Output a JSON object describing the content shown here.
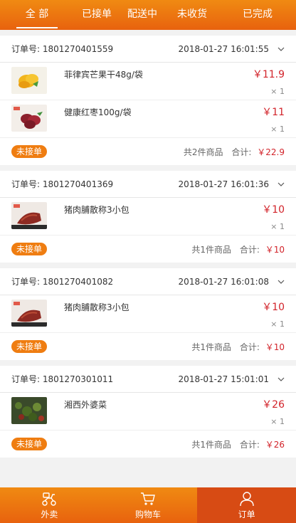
{
  "tabs": [
    {
      "label": "全  部",
      "active": true
    },
    {
      "label": "已接单"
    },
    {
      "label": "配送中"
    },
    {
      "label": "未收货"
    },
    {
      "label": "已完成"
    }
  ],
  "orders": [
    {
      "number": "订单号: 1801270401559",
      "time": "2018-01-27 16:01:55",
      "items": [
        {
          "name": "菲律宾芒果干48g/袋",
          "price": "￥11.9",
          "qty": "× 1",
          "thumb": "mango"
        },
        {
          "name": "健康红枣100g/袋",
          "price": "￥11",
          "qty": "× 1",
          "thumb": "dates"
        }
      ],
      "status": "未接单",
      "count": "共2件商品",
      "sum_label": "合计:",
      "total": "￥22.9"
    },
    {
      "number": "订单号: 1801270401369",
      "time": "2018-01-27 16:01:36",
      "items": [
        {
          "name": "猪肉脯散称3小包",
          "price": "￥10",
          "qty": "× 1",
          "thumb": "pork"
        }
      ],
      "status": "未接单",
      "count": "共1件商品",
      "sum_label": "合计:",
      "total": "￥10"
    },
    {
      "number": "订单号: 1801270401082",
      "time": "2018-01-27 16:01:08",
      "items": [
        {
          "name": "猪肉脯散称3小包",
          "price": "￥10",
          "qty": "× 1",
          "thumb": "pork"
        }
      ],
      "status": "未接单",
      "count": "共1件商品",
      "sum_label": "合计:",
      "total": "￥10"
    },
    {
      "number": "订单号: 1801270301011",
      "time": "2018-01-27 15:01:01",
      "items": [
        {
          "name": "湘西外婆菜",
          "price": "￥26",
          "qty": "× 1",
          "thumb": "greens"
        }
      ],
      "status": "未接单",
      "count": "共1件商品",
      "sum_label": "合计:",
      "total": "￥26"
    }
  ],
  "nav": [
    {
      "label": "外卖",
      "icon": "delivery-scooter-icon"
    },
    {
      "label": "购物车",
      "icon": "shopping-cart-icon"
    },
    {
      "label": "订单",
      "icon": "person-icon",
      "active": true
    }
  ],
  "colors": {
    "brand": "#ef7d11",
    "price": "#d2232a",
    "nav_active": "#d74b14"
  }
}
